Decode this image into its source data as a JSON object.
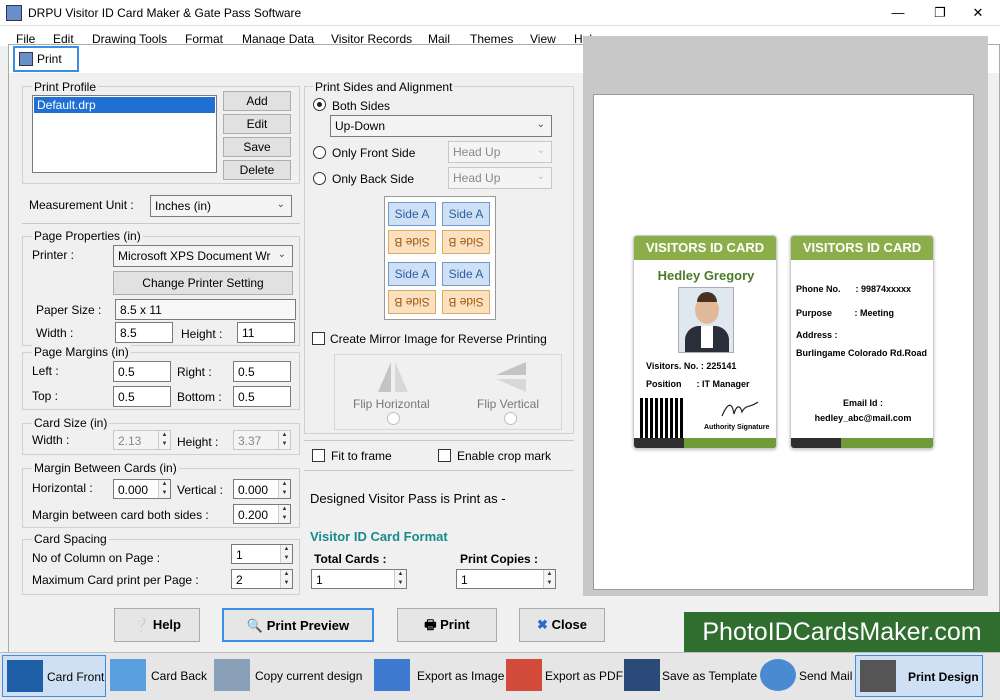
{
  "app": {
    "title": "DRPU Visitor ID Card Maker & Gate Pass Software",
    "menu": [
      "File",
      "Edit",
      "Drawing Tools",
      "Format",
      "Manage Data",
      "Visitor Records",
      "Mail",
      "Themes",
      "View",
      "Help"
    ]
  },
  "dialog": {
    "title": "Print",
    "print_profile": {
      "legend": "Print Profile",
      "profiles": [
        "Default.drp"
      ],
      "add": "Add",
      "edit": "Edit",
      "save": "Save",
      "delete": "Delete"
    },
    "measurement_unit": {
      "label": "Measurement Unit :",
      "value": "Inches (in)"
    },
    "page_properties": {
      "legend": "Page Properties (in)",
      "printer_label": "Printer :",
      "printer_value": "Microsoft XPS Document Wr",
      "change_printer": "Change Printer Setting",
      "paper_size_label": "Paper Size :",
      "paper_size_value": "8.5 x 11",
      "width_label": "Width :",
      "width_value": "8.5",
      "height_label": "Height :",
      "height_value": "11"
    },
    "page_margins": {
      "legend": "Page Margins (in)",
      "left_label": "Left :",
      "left_value": "0.5",
      "right_label": "Right :",
      "right_value": "0.5",
      "top_label": "Top :",
      "top_value": "0.5",
      "bottom_label": "Bottom :",
      "bottom_value": "0.5"
    },
    "card_size": {
      "legend": "Card Size (in)",
      "width_label": "Width :",
      "width_value": "2.13",
      "height_label": "Height :",
      "height_value": "3.37"
    },
    "margin_between": {
      "legend": "Margin Between Cards (in)",
      "horizontal_label": "Horizontal :",
      "horizontal_value": "0.000",
      "vertical_label": "Vertical :",
      "vertical_value": "0.000",
      "both_label": "Margin between card both sides :",
      "both_value": "0.200"
    },
    "card_spacing": {
      "legend": "Card Spacing",
      "columns_label": "No of Column on Page :",
      "columns_value": "1",
      "max_label": "Maximum Card print per Page :",
      "max_value": "2"
    },
    "sides": {
      "legend": "Print Sides and Alignment",
      "both": "Both Sides",
      "both_value": "Up-Down",
      "front": "Only Front Side",
      "front_value": "Head Up",
      "back": "Only Back Side",
      "back_value": "Head Up",
      "side_a": "Side A",
      "side_b": "Side B"
    },
    "mirror": "Create Mirror Image for Reverse Printing",
    "flip_h": "Flip Horizontal",
    "flip_v": "Flip Vertical",
    "fit_frame": "Fit to frame",
    "crop_mark": "Enable crop mark",
    "designed_as": "Designed Visitor Pass is Print as -",
    "format": "Visitor ID Card Format",
    "total_cards_label": "Total Cards :",
    "total_cards_value": "1",
    "copies_label": "Print Copies :",
    "copies_value": "1",
    "buttons": {
      "help": "Help",
      "preview": "Print Preview",
      "print": "Print",
      "close": "Close"
    }
  },
  "card_front": {
    "header": "VISITORS ID CARD",
    "name": "Hedley Gregory",
    "visitor_no": "Visitors. No. : 225141",
    "position": "Position      : IT Manager",
    "signature": "Authority Signature"
  },
  "card_back": {
    "header": "VISITORS ID CARD",
    "phone": "Phone No.      : 99874xxxxx",
    "purpose": "Purpose         : Meeting",
    "address_label": "Address :",
    "address": "Burlingame Colorado Rd.Road",
    "email_label": "Email Id :",
    "email": "hedley_abc@mail.com"
  },
  "watermark": "PhotoIDCardsMaker.com",
  "toolbar": {
    "card_front": "Card Front",
    "card_back": "Card Back",
    "copy": "Copy current design",
    "export_image": "Export as Image",
    "export_pdf": "Export as PDF",
    "template": "Save as Template",
    "mail": "Send Mail",
    "print_design": "Print Design"
  },
  "colors": {
    "card_green": "#8bae4a",
    "highlight_blue": "#3a8ee6",
    "format_teal": "#1a8a8a"
  }
}
